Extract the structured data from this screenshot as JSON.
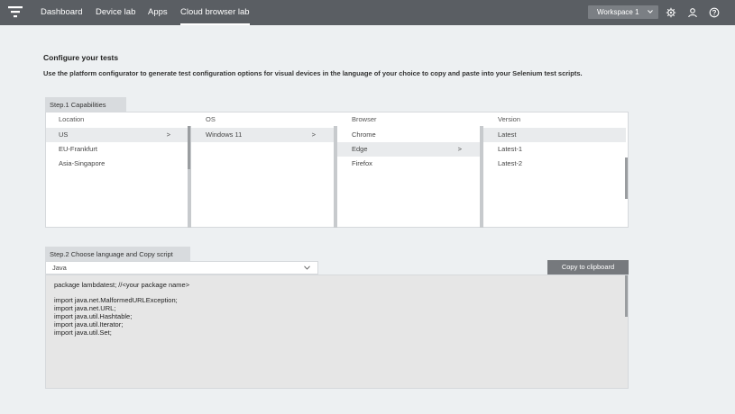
{
  "nav": {
    "items": [
      {
        "label": "Dashboard",
        "active": false
      },
      {
        "label": "Device lab",
        "active": false
      },
      {
        "label": "Apps",
        "active": false
      },
      {
        "label": "Cloud browser lab",
        "active": true
      }
    ],
    "workspace_label": "Workspace 1",
    "icons": [
      "gear-icon",
      "user-icon",
      "help-icon"
    ]
  },
  "page": {
    "title": "Configure your tests",
    "subtitle": "Use the platform configurator to generate test configuration options for visual devices in the language of your choice to copy and paste into your Selenium test scripts."
  },
  "step1": {
    "label": "Step.1 Capabilities",
    "columns": [
      {
        "header": "Location",
        "items": [
          {
            "label": "US",
            "selected": true,
            "arrow": ">"
          },
          {
            "label": "EU-Frankfurt"
          },
          {
            "label": "Asia-Singapore"
          }
        ]
      },
      {
        "header": "OS",
        "items": [
          {
            "label": "Windows 11",
            "selected": true,
            "arrow": ">"
          }
        ]
      },
      {
        "header": "Browser",
        "items": [
          {
            "label": "Chrome"
          },
          {
            "label": "Edge",
            "selected": true,
            "arrow": ">"
          },
          {
            "label": "Firefox"
          }
        ]
      },
      {
        "header": "Version",
        "items": [
          {
            "label": "Latest",
            "selected": true
          },
          {
            "label": "Latest-1"
          },
          {
            "label": "Latest-2"
          }
        ]
      }
    ]
  },
  "step2": {
    "label": "Step.2 Choose language and Copy script",
    "language": "Java",
    "copy_label": "Copy to clipboard",
    "code_lines": [
      "package lambdatest; //<your package name>",
      "",
      "import java.net.MalformedURLException;",
      "import java.net.URL;",
      "import java.util.Hashtable;",
      "import java.util.Iterator;",
      "import java.util.Set;"
    ]
  },
  "colors": {
    "topbar": "#5a5e63",
    "background": "#edf0f2",
    "button": "#76797d"
  }
}
